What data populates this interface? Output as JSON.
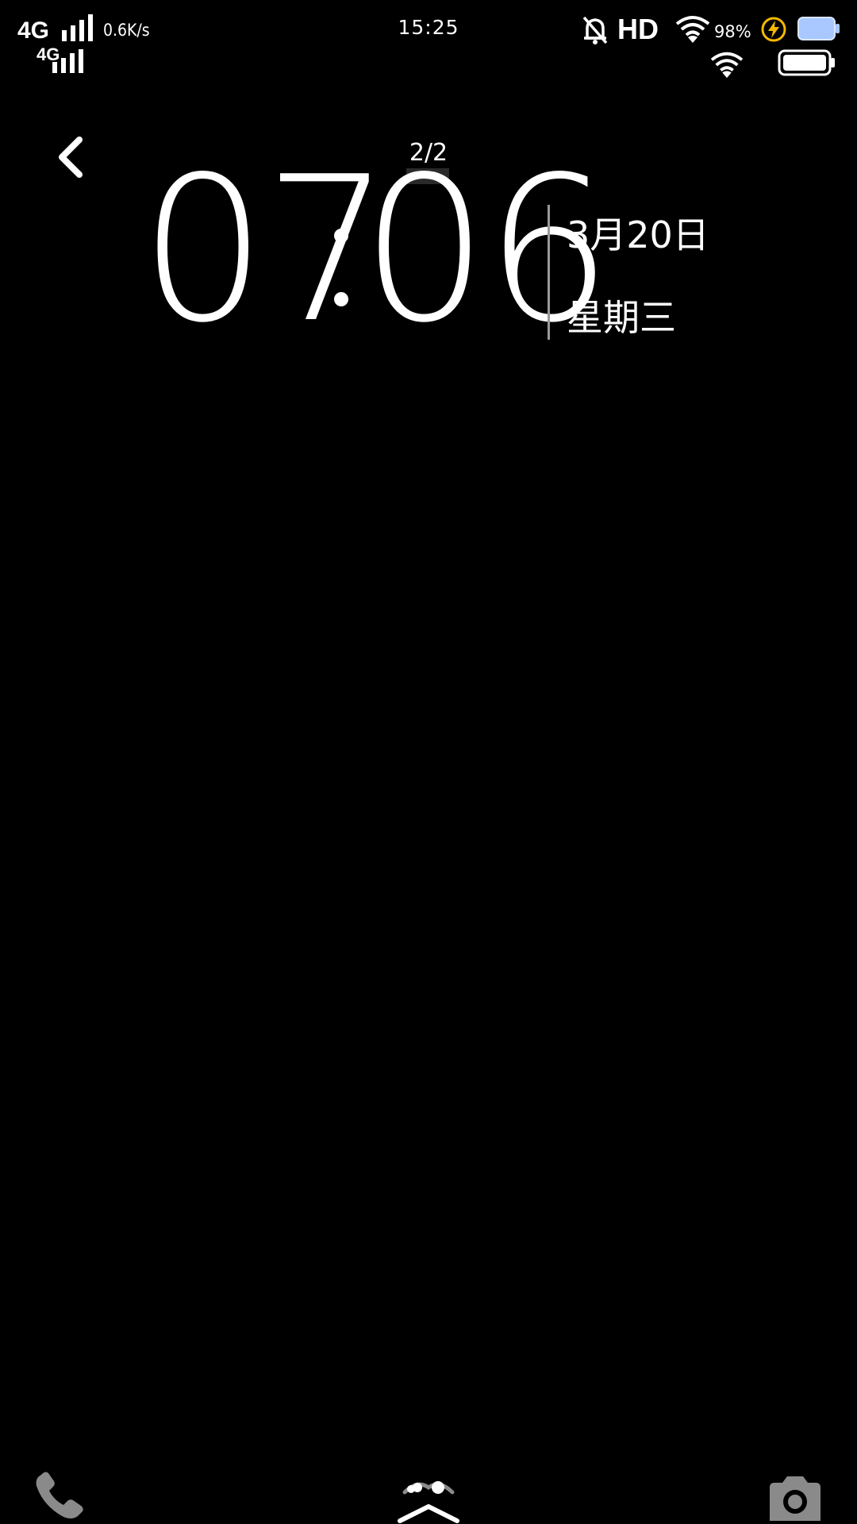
{
  "status_bar": {
    "sim1_type": "4G",
    "sim2_type": "4G",
    "network_speed": "0.6K/s",
    "time": "15:25",
    "hd_label": "HD",
    "battery_percent": "98%",
    "icons": [
      "signal-icon",
      "mute-bell-icon",
      "wifi-icon",
      "charging-icon",
      "battery-icon"
    ]
  },
  "header": {
    "page_indicator": "2/2"
  },
  "clock": {
    "hours": "07",
    "minutes": "06",
    "date": "3月20日",
    "weekday": "星期三"
  },
  "bottom_bar": {
    "icons": [
      "phone-icon",
      "unlock-arrow-icon",
      "camera-icon"
    ]
  },
  "colors": {
    "background": "#000000",
    "foreground": "#ffffff",
    "dim": "#8a8a8a",
    "charge": "#f5b800",
    "battery_fill": "#a8c8ff"
  }
}
